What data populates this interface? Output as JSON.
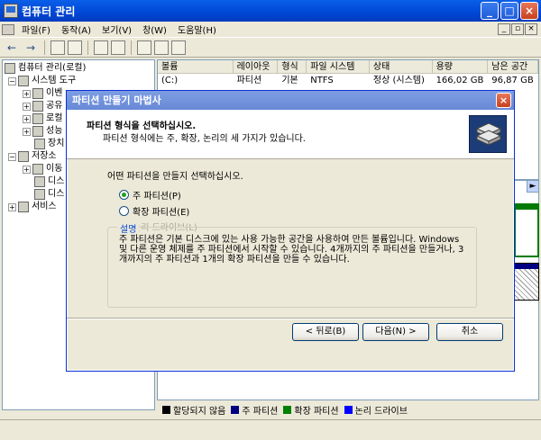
{
  "app": {
    "title": "컴퓨터 관리"
  },
  "menubar": {
    "items": [
      "파일(F)",
      "동작(A)",
      "보기(V)",
      "창(W)",
      "도움말(H)"
    ]
  },
  "tree": {
    "items": [
      {
        "label": "컴퓨터 관리(로컬)",
        "level": 0,
        "icon": "computer-icon"
      },
      {
        "label": "시스템 도구",
        "level": 1,
        "icon": "tools-icon"
      },
      {
        "label": "이벤",
        "level": 2,
        "icon": "event-viewer-icon"
      },
      {
        "label": "공유",
        "level": 2,
        "icon": "shared-folder-icon"
      },
      {
        "label": "로컬",
        "level": 2,
        "icon": "users-icon"
      },
      {
        "label": "성능",
        "level": 2,
        "icon": "performance-icon"
      },
      {
        "label": "장치",
        "level": 2,
        "icon": "device-icon"
      },
      {
        "label": "저장소",
        "level": 1,
        "icon": "storage-icon"
      },
      {
        "label": "이동",
        "level": 2,
        "icon": "removable-icon"
      },
      {
        "label": "디스",
        "level": 2,
        "icon": "defrag-icon"
      },
      {
        "label": "디스",
        "level": 2,
        "icon": "disk-management-icon"
      },
      {
        "label": "서비스",
        "level": 1,
        "icon": "services-icon"
      }
    ]
  },
  "volumes": {
    "columns": [
      "볼륨",
      "레이아웃",
      "형식",
      "파일 시스템",
      "상태",
      "용량",
      "남은 공간"
    ],
    "rows": [
      {
        "volume": "(C:)",
        "layout": "파티션",
        "type": "기본",
        "fs": "NTFS",
        "status": "정상 (시스템)",
        "capacity": "166,02 GB",
        "free": "96,87 GB"
      }
    ]
  },
  "legend": {
    "items": [
      {
        "label": "할당되지 않음",
        "color": "#000000"
      },
      {
        "label": "주 파티션",
        "color": "#000080"
      },
      {
        "label": "확장 파티션",
        "color": "#008000"
      },
      {
        "label": "논리 드라이브",
        "color": "#0000ff"
      }
    ]
  },
  "wizard": {
    "title": "파티션 만들기 마법사",
    "heading": "파티션 형식을 선택하십시오.",
    "subheading": "파티션 형식에는 주, 확장, 논리의 세 가지가 있습니다.",
    "prompt": "어떤 파티션을 만들지 선택하십시오.",
    "options": [
      {
        "label": "주 파티션(P)",
        "selected": true,
        "enabled": true
      },
      {
        "label": "확장 파티션(E)",
        "selected": false,
        "enabled": true
      },
      {
        "label": "논리 드라이브(L)",
        "selected": false,
        "enabled": false
      }
    ],
    "description_title": "설명",
    "description": "주 파티션은 기본 디스크에 있는 사용 가능한 공간을 사용하여 만든 볼륨입니다. Windows 및 다른 운영 체제를 주 파티션에서 시작할 수 있습니다. 4개까지의 주 파티션을 만들거나, 3개까지의 주 파티션과 1개의 확장 파티션을 만들 수 있습니다.",
    "back_label": "< 뒤로(B)",
    "next_label": "다음(N) >",
    "cancel_label": "취소"
  }
}
